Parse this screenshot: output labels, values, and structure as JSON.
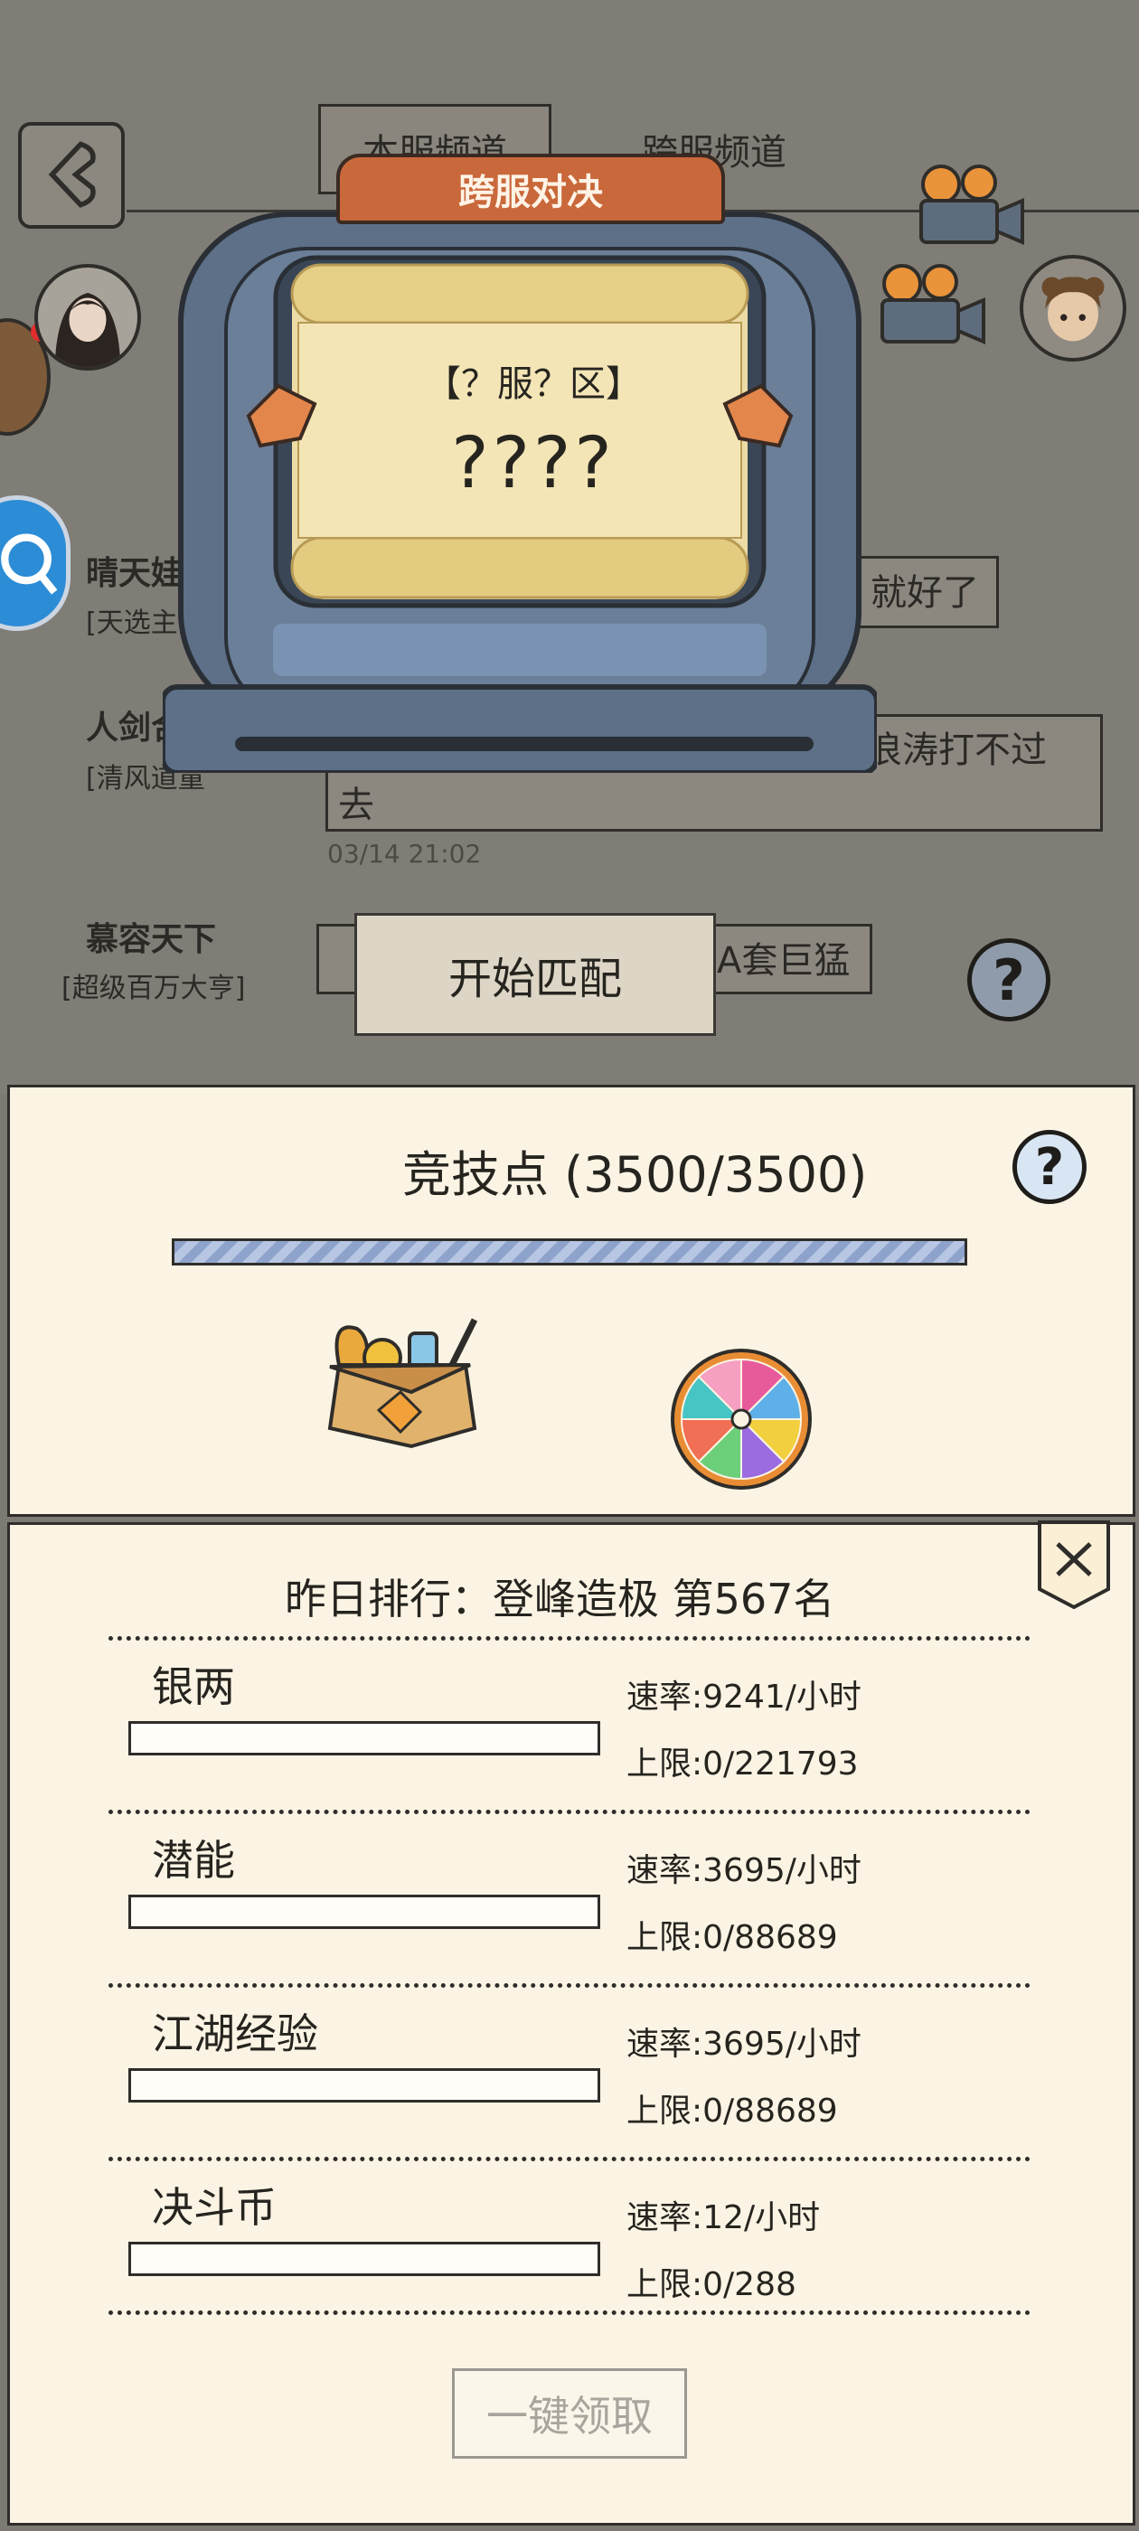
{
  "chat": {
    "tabs": [
      "本服频道",
      "跨服频道"
    ],
    "messages": [
      {
        "name": "晴天娃",
        "title": "[天选主角",
        "text": "就好了"
      },
      {
        "name": "人剑合",
        "title": "[清风道童",
        "text": "浪涛打不过",
        "text2": "去",
        "time": "03/14 21:02"
      },
      {
        "name": "慕容天下",
        "title": "[超级百万大亨]",
        "text": "A套巨猛"
      }
    ]
  },
  "machine": {
    "title": "跨服对决",
    "server_label": "【？服？区】",
    "server_name": "????"
  },
  "start_button": "开始匹配",
  "arena": {
    "title": "竞技点 (3500/3500)",
    "current": 3500,
    "max": 3500
  },
  "ranking": {
    "title": "昨日排行：登峰造极 第567名",
    "resources": [
      {
        "name": "银两",
        "rate": "速率:9241/小时",
        "cap": "上限:0/221793"
      },
      {
        "name": "潜能",
        "rate": "速率:3695/小时",
        "cap": "上限:0/88689"
      },
      {
        "name": "江湖经验",
        "rate": "速率:3695/小时",
        "cap": "上限:0/88689"
      },
      {
        "name": "决斗币",
        "rate": "速率:12/小时",
        "cap": "上限:0/288"
      }
    ],
    "claim_button": "一键领取"
  },
  "colors": {
    "panel_bg": "#fbf4e4",
    "machine_body": "#5d7088",
    "title_plate": "#c9683a",
    "progress": "#8ea3cc",
    "overlay_bg": "#807d76"
  }
}
